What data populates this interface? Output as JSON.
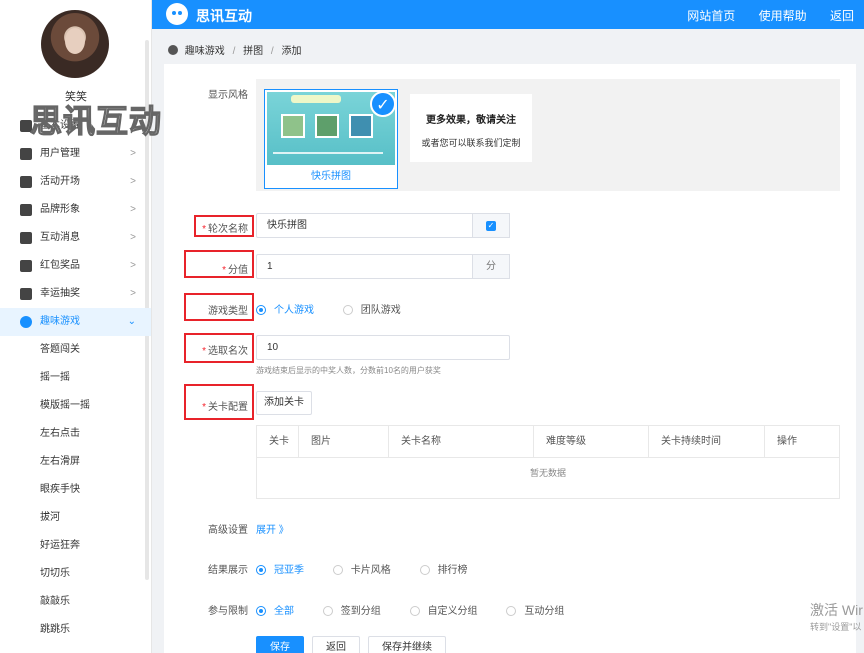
{
  "user": {
    "name": "笑笑"
  },
  "watermark": "思讯互动",
  "sidebar": {
    "items": [
      {
        "label": "基本设置",
        "icon": "gear-icon"
      },
      {
        "label": "用户管理",
        "icon": "user-icon"
      },
      {
        "label": "活动开场",
        "icon": "send-icon"
      },
      {
        "label": "品牌形象",
        "icon": "registered-icon"
      },
      {
        "label": "互动消息",
        "icon": "chat-icon"
      },
      {
        "label": "红包奖品",
        "icon": "gift-icon"
      },
      {
        "label": "幸运抽奖",
        "icon": "lottery-icon"
      },
      {
        "label": "趣味游戏",
        "icon": "gamepad-icon"
      }
    ],
    "sub_items": [
      "答题闯关",
      "摇一摇",
      "模版摇一摇",
      "左右点击",
      "左右滑屏",
      "眼疾手快",
      "拔河",
      "好运狂奔",
      "切切乐",
      "敲敲乐",
      "跳跳乐"
    ]
  },
  "header": {
    "brand": "思讯互动",
    "links": [
      "网站首页",
      "使用帮助",
      "返回"
    ],
    "accent": "#1890ff"
  },
  "breadcrumb": [
    "趣味游戏",
    "拼图",
    "添加"
  ],
  "form": {
    "display_style_label": "显示风格",
    "theme_name": "快乐拼图",
    "more_title": "更多效果，敬请关注",
    "more_sub": "或者您可以联系我们定制",
    "round_name_label": "轮次名称",
    "round_name_value": "快乐拼图",
    "score_label": "分值",
    "score_value": "1",
    "score_unit": "分",
    "game_type_label": "游戏类型",
    "game_type_options": [
      "个人游戏",
      "团队游戏"
    ],
    "pick_label": "选取名次",
    "pick_value": "10",
    "pick_hint": "游戏结束后显示的中奖人数，分数前10名的用户获奖",
    "level_label": "关卡配置",
    "add_level_button": "添加关卡",
    "table_headers": [
      "关卡",
      "图片",
      "关卡名称",
      "难度等级",
      "关卡持续时间",
      "操作"
    ],
    "empty_text": "暂无数据",
    "advanced_label": "高级设置",
    "advanced_link": "展开 》",
    "result_label": "结果展示",
    "result_options": [
      "冠亚季",
      "卡片风格",
      "排行榜"
    ],
    "limit_label": "参与限制",
    "limit_options": [
      "全部",
      "签到分组",
      "自定义分组",
      "互动分组"
    ],
    "buttons": {
      "save": "保存",
      "back": "返回",
      "save_continue": "保存并继续"
    }
  },
  "os_overlay": {
    "line1": "激活 Wir",
    "line2": "转到\"设置\"以"
  }
}
